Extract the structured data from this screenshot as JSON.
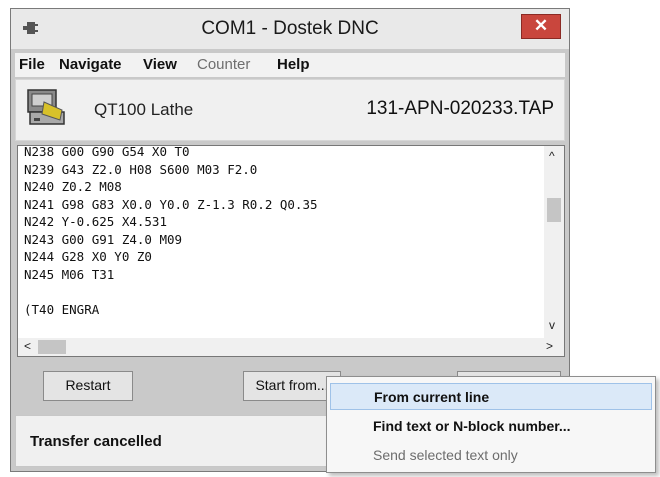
{
  "window": {
    "title": "COM1 - Dostek DNC",
    "close_glyph": "✕"
  },
  "menu": {
    "items": [
      {
        "label": "File",
        "enabled": true
      },
      {
        "label": "Navigate",
        "enabled": true
      },
      {
        "label": "View",
        "enabled": true
      },
      {
        "label": "Counter",
        "enabled": false
      },
      {
        "label": "Help",
        "enabled": true
      }
    ]
  },
  "info": {
    "machine_icon": "lathe-machine-icon",
    "machine_name": "QT100 Lathe",
    "file_name": "131-APN-020233.TAP"
  },
  "code": {
    "lines": [
      "N238 G00 G90 G54 X0 T0",
      "N239 G43 Z2.0 H08 S600 M03 F2.0",
      "N240 Z0.2 M08",
      "N241 G98 G83 X0.0 Y0.0 Z-1.3 R0.2 Q0.35",
      "N242 Y-0.625 X4.531",
      "N243 G00 G91 Z4.0 M09",
      "N244 G28 X0 Y0 Z0",
      "N245 M06 T31",
      "",
      "(T40 ENGRA"
    ],
    "vscroll_up": "^",
    "vscroll_down": "v",
    "hscroll_left": "<",
    "hscroll_right": ">"
  },
  "buttons": {
    "restart": "Restart",
    "start_from": "Start from..."
  },
  "status": {
    "text": "Transfer cancelled"
  },
  "context_menu": {
    "items": [
      {
        "label": "From current line",
        "state": "highlighted"
      },
      {
        "label": "Find text or N-block number...",
        "state": "enabled"
      },
      {
        "label": "Send selected text only",
        "state": "disabled"
      }
    ]
  },
  "colors": {
    "close_button": "#c9463d",
    "window_frame": "#c9c9c9",
    "menu_highlight": "#dbe9f8"
  }
}
